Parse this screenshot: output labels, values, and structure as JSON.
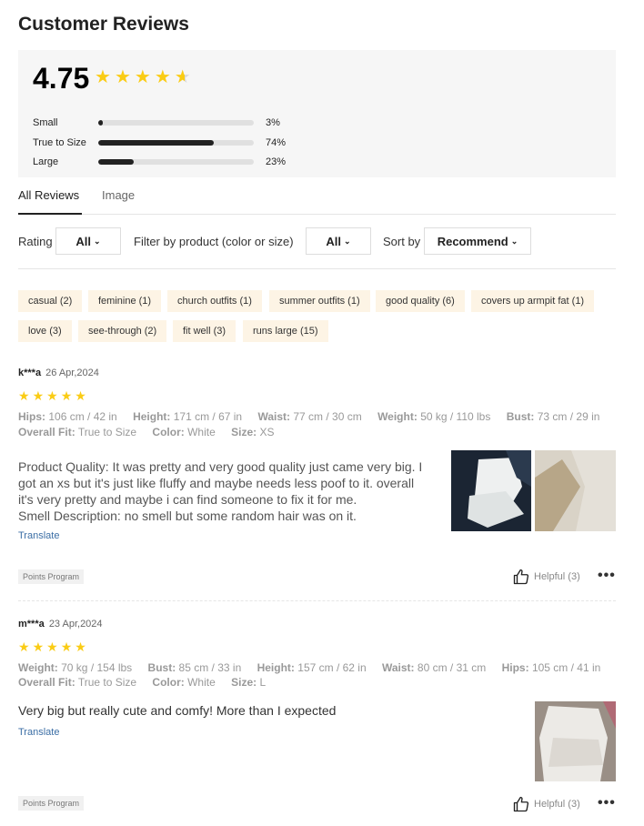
{
  "page": {
    "title": "Customer Reviews"
  },
  "summary": {
    "score": "4.75",
    "stars": 4.75,
    "fit": [
      {
        "label": "Small",
        "pct": "3%",
        "value": 0.03
      },
      {
        "label": "True to Size",
        "pct": "74%",
        "value": 0.74
      },
      {
        "label": "Large",
        "pct": "23%",
        "value": 0.23
      }
    ]
  },
  "tabs": {
    "all": "All Reviews",
    "image": "Image"
  },
  "filters": {
    "rating_label": "Rating",
    "rating_value": "All",
    "product_label": "Filter by product  (color or size)",
    "product_value": "All",
    "sort_label": "Sort by",
    "sort_value": "Recommend"
  },
  "tags": [
    "casual (2)",
    "feminine (1)",
    "church outfits (1)",
    "summer outfits (1)",
    "good quality (6)",
    "covers up armpit fat (1)",
    "love (3)",
    "see-through (2)",
    "fit well (3)",
    "runs large (15)"
  ],
  "reviews": [
    {
      "user": "k***a",
      "date": "26 Apr,2024",
      "stars": 5,
      "specs_line1": [
        {
          "k": "Hips:",
          "v": "106 cm / 42 in"
        },
        {
          "k": "Height:",
          "v": "171 cm / 67 in"
        },
        {
          "k": "Waist:",
          "v": "77 cm / 30 cm"
        },
        {
          "k": "Weight:",
          "v": "50 kg / 110 lbs"
        },
        {
          "k": "Bust:",
          "v": "73 cm / 29 in"
        }
      ],
      "specs_line2": [
        {
          "k": "Overall Fit:",
          "v": "True to Size"
        },
        {
          "k": "Color:",
          "v": "White"
        },
        {
          "k": "Size:",
          "v": "XS"
        }
      ],
      "text_lines": [
        "Product Quality: It was pretty and very good quality just came very big. I",
        "got an xs but it's just like fluffy and maybe needs less poof to it. overall",
        "it's very pretty and maybe i can find someone to fix it for me.",
        "Smell Description: no smell but some random hair was on it."
      ],
      "translate": "Translate",
      "badge": "Points Program",
      "helpful": "Helpful (3)"
    },
    {
      "user": "m***a",
      "date": "23 Apr,2024",
      "stars": 5,
      "specs_line1": [
        {
          "k": "Weight:",
          "v": "70 kg / 154 lbs"
        },
        {
          "k": "Bust:",
          "v": "85 cm / 33 in"
        },
        {
          "k": "Height:",
          "v": "157 cm / 62 in"
        },
        {
          "k": "Waist:",
          "v": "80 cm / 31 cm"
        },
        {
          "k": "Hips:",
          "v": "105 cm / 41 in"
        }
      ],
      "specs_line2": [
        {
          "k": "Overall Fit:",
          "v": "True to Size"
        },
        {
          "k": "Color:",
          "v": "White"
        },
        {
          "k": "Size:",
          "v": "L"
        }
      ],
      "text_lines": [
        "Very big but really cute and comfy! More than I expected"
      ],
      "translate": "Translate",
      "badge": "Points Program",
      "helpful": "Helpful (3)"
    }
  ],
  "colors": {
    "star": "#facc15",
    "tag_bg": "#fdf4e5",
    "link": "#3b6ea5"
  },
  "icons": {
    "star": "star-icon",
    "helpful": "thumbs-up-icon",
    "more": "more-dots-icon",
    "chevron": "chevron-down-icon"
  }
}
